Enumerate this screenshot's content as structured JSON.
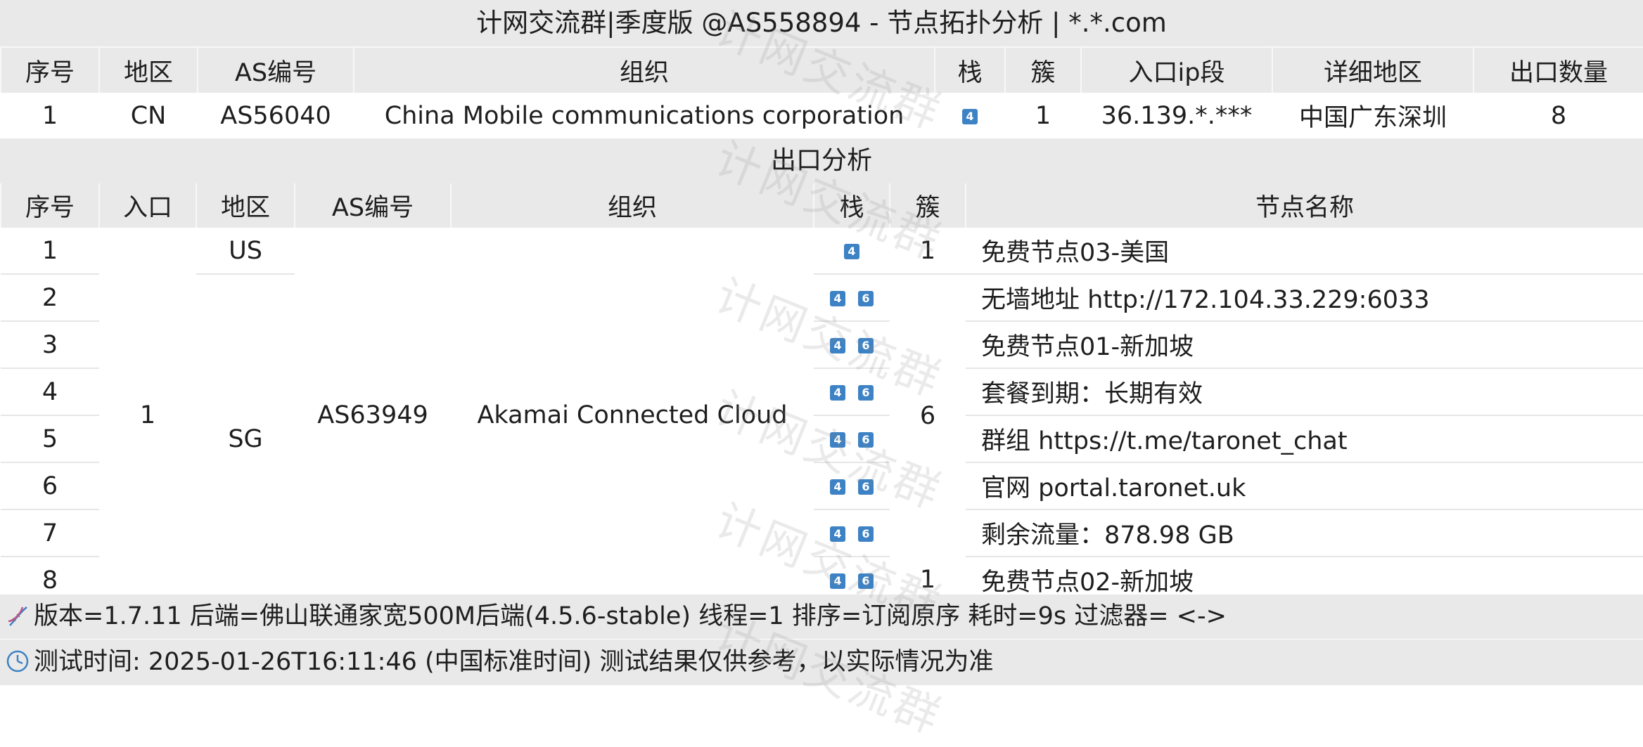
{
  "title": "计网交流群|季度版 @AS558894 - 节点拓扑分析 | *.*.com",
  "entry_table": {
    "headers": [
      "序号",
      "地区",
      "AS编号",
      "组织",
      "栈",
      "簇",
      "入口ip段",
      "详细地区",
      "出口数量"
    ],
    "row": {
      "index": "1",
      "region": "CN",
      "asn": "AS56040",
      "org": "China Mobile communications corporation",
      "stack": [
        "4"
      ],
      "cluster": "1",
      "ip_range": "36.139.*.***",
      "detail_region": "中国广东深圳",
      "exit_count": "8"
    }
  },
  "exit_section_title": "出口分析",
  "exit_table": {
    "headers": [
      "序号",
      "入口",
      "地区",
      "AS编号",
      "组织",
      "栈",
      "簇",
      "节点名称"
    ],
    "entry": "1",
    "asn": "AS63949",
    "org": "Akamai Connected Cloud",
    "region_us": "US",
    "region_sg": "SG",
    "cluster_a": "1",
    "cluster_b": "6",
    "cluster_c": "1",
    "rows": [
      {
        "index": "1",
        "stack": [
          "4"
        ],
        "name": "免费节点03-美国"
      },
      {
        "index": "2",
        "stack": [
          "4",
          "6"
        ],
        "name": "无墙地址 http://172.104.33.229:6033"
      },
      {
        "index": "3",
        "stack": [
          "4",
          "6"
        ],
        "name": "免费节点01-新加坡"
      },
      {
        "index": "4",
        "stack": [
          "4",
          "6"
        ],
        "name": "套餐到期：长期有效"
      },
      {
        "index": "5",
        "stack": [
          "4",
          "6"
        ],
        "name": "群组 https://t.me/taronet_chat"
      },
      {
        "index": "6",
        "stack": [
          "4",
          "6"
        ],
        "name": "官网 portal.taronet.uk"
      },
      {
        "index": "7",
        "stack": [
          "4",
          "6"
        ],
        "name": "剩余流量：878.98 GB"
      },
      {
        "index": "8",
        "stack": [
          "4",
          "6"
        ],
        "name": "免费节点02-新加坡"
      }
    ]
  },
  "footer": {
    "line1": "版本=1.7.11  后端=佛山联通家宽500M后端(4.5.6-stable)   线程=1  排序=订阅原序  耗时=9s    过滤器= <->",
    "line2": "测试时间: 2025-01-26T16:11:46 (中国标准时间)  测试结果仅供参考，以实际情况为准"
  },
  "watermark": "计网交流群",
  "colors": {
    "header_bg": "#e9e9e9",
    "badge": "#3d82c4",
    "row_bg": "#ffffff"
  }
}
